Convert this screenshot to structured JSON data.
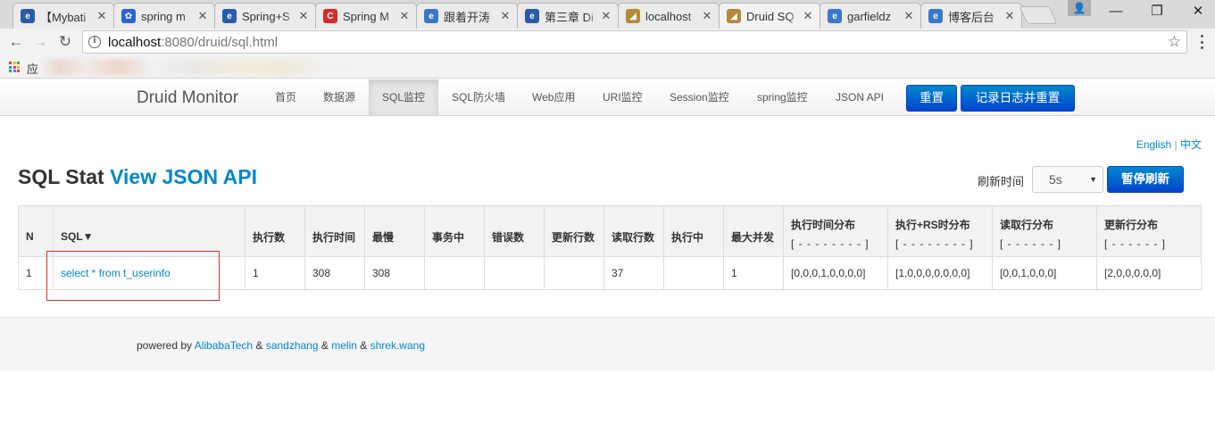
{
  "browser": {
    "tabs": [
      {
        "title": "【Mybati",
        "favicon_color": "#2a5caa",
        "favicon_glyph": "e"
      },
      {
        "title": "spring m",
        "favicon_color": "#2c62d6",
        "favicon_glyph": "✿"
      },
      {
        "title": "Spring+S",
        "favicon_color": "#2a5caa",
        "favicon_glyph": "e"
      },
      {
        "title": "Spring M",
        "favicon_color": "#d42b2b",
        "favicon_glyph": "C"
      },
      {
        "title": "跟着开涛",
        "favicon_color": "#3a78c8",
        "favicon_glyph": "e"
      },
      {
        "title": "第三章 Di",
        "favicon_color": "#2a5caa",
        "favicon_glyph": "e"
      },
      {
        "title": "localhost",
        "favicon_color": "#b58a3a",
        "favicon_glyph": "◢"
      },
      {
        "title": "Druid SQ",
        "favicon_color": "#b58a3a",
        "favicon_glyph": "◢",
        "active": true
      },
      {
        "title": "garfieldz",
        "favicon_color": "#3a78c8",
        "favicon_glyph": "e"
      },
      {
        "title": "博客后台",
        "favicon_color": "#3a78c8",
        "favicon_glyph": "e"
      }
    ],
    "url_host": "localhost",
    "url_path": ":8080/druid/sql.html",
    "bookmarks_apps_label": "应"
  },
  "navbar": {
    "brand": "Druid Monitor",
    "links": [
      "首页",
      "数据源",
      "SQL监控",
      "SQL防火墙",
      "Web应用",
      "URI监控",
      "Session监控",
      "spring监控",
      "JSON API"
    ],
    "active_link": "SQL监控",
    "reset_button": "重置",
    "log_reset_button": "记录日志并重置"
  },
  "lang": {
    "english": "English",
    "separator": "|",
    "chinese": "中文"
  },
  "page": {
    "title": "SQL Stat",
    "json_link": "View JSON API",
    "refresh_label": "刷新时间",
    "refresh_value": "5s",
    "pause_button": "暂停刷新"
  },
  "table": {
    "headers": [
      {
        "label": "N"
      },
      {
        "label": "SQL▼"
      },
      {
        "label": "执行数"
      },
      {
        "label": "执行时间"
      },
      {
        "label": "最慢"
      },
      {
        "label": "事务中"
      },
      {
        "label": "错误数"
      },
      {
        "label": "更新行数"
      },
      {
        "label": "读取行数"
      },
      {
        "label": "执行中"
      },
      {
        "label": "最大并发"
      },
      {
        "label": "执行时间分布",
        "sub": "[ - - - - - - - - ]"
      },
      {
        "label": "执行+RS时分布",
        "sub": "[ - - - - - - - - ]"
      },
      {
        "label": "读取行分布",
        "sub": "[ - - - - - - ]"
      },
      {
        "label": "更新行分布",
        "sub": "[ - - - - - - ]"
      }
    ],
    "rows": [
      {
        "cells": [
          "1",
          "select * from t_userinfo",
          "1",
          "308",
          "308",
          "",
          "",
          "",
          "37",
          "",
          "1",
          "[0,0,0,1,0,0,0,0]",
          "[1,0,0,0,0,0,0,0]",
          "[0,0,1,0,0,0]",
          "[2,0,0,0,0,0]"
        ]
      }
    ]
  },
  "footer": {
    "prefix": "powered by",
    "authors": [
      "AlibabaTech",
      "sandzhang",
      "melin",
      "shrek.wang"
    ],
    "sep": "&"
  },
  "colors": {
    "link": "#0088cc",
    "primary_button": "#0055cc",
    "highlight_box": "#d9302c"
  }
}
